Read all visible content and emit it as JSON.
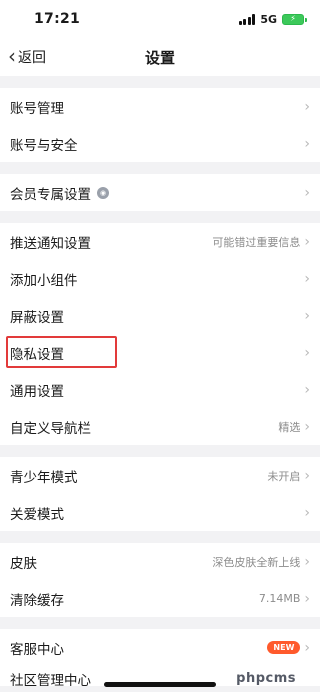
{
  "status_bar": {
    "time": "17:21",
    "network": "5G",
    "battery_state": "charging",
    "battery_color": "#3cc95a",
    "signal_bars": 4
  },
  "nav": {
    "back_label": "返回",
    "title": "设置"
  },
  "groups": [
    {
      "items": [
        {
          "label": "账号管理",
          "value": ""
        },
        {
          "label": "账号与安全",
          "value": ""
        }
      ]
    },
    {
      "items": [
        {
          "label": "会员专属设置",
          "value": "",
          "icon": "vip-badge-icon"
        }
      ]
    },
    {
      "items": [
        {
          "label": "推送通知设置",
          "value": "可能错过重要信息"
        },
        {
          "label": "添加小组件",
          "value": ""
        },
        {
          "label": "屏蔽设置",
          "value": ""
        },
        {
          "label": "隐私设置",
          "value": "",
          "highlighted": true,
          "highlight_color": "#e23a3a"
        },
        {
          "label": "通用设置",
          "value": ""
        },
        {
          "label": "自定义导航栏",
          "value": "精选"
        }
      ]
    },
    {
      "items": [
        {
          "label": "青少年模式",
          "value": "未开启"
        },
        {
          "label": "关爱模式",
          "value": ""
        }
      ]
    },
    {
      "items": [
        {
          "label": "皮肤",
          "value": "深色皮肤全新上线"
        },
        {
          "label": "清除缓存",
          "value": "7.14MB"
        }
      ]
    },
    {
      "items": [
        {
          "label": "客服中心",
          "value": "",
          "badge": "NEW",
          "badge_color": "#ff5a2c"
        },
        {
          "label": "社区管理中心",
          "value": "",
          "partial": true
        }
      ]
    }
  ],
  "watermark": "phpcms",
  "arrow_glyph": "›",
  "back_glyph": "‹"
}
